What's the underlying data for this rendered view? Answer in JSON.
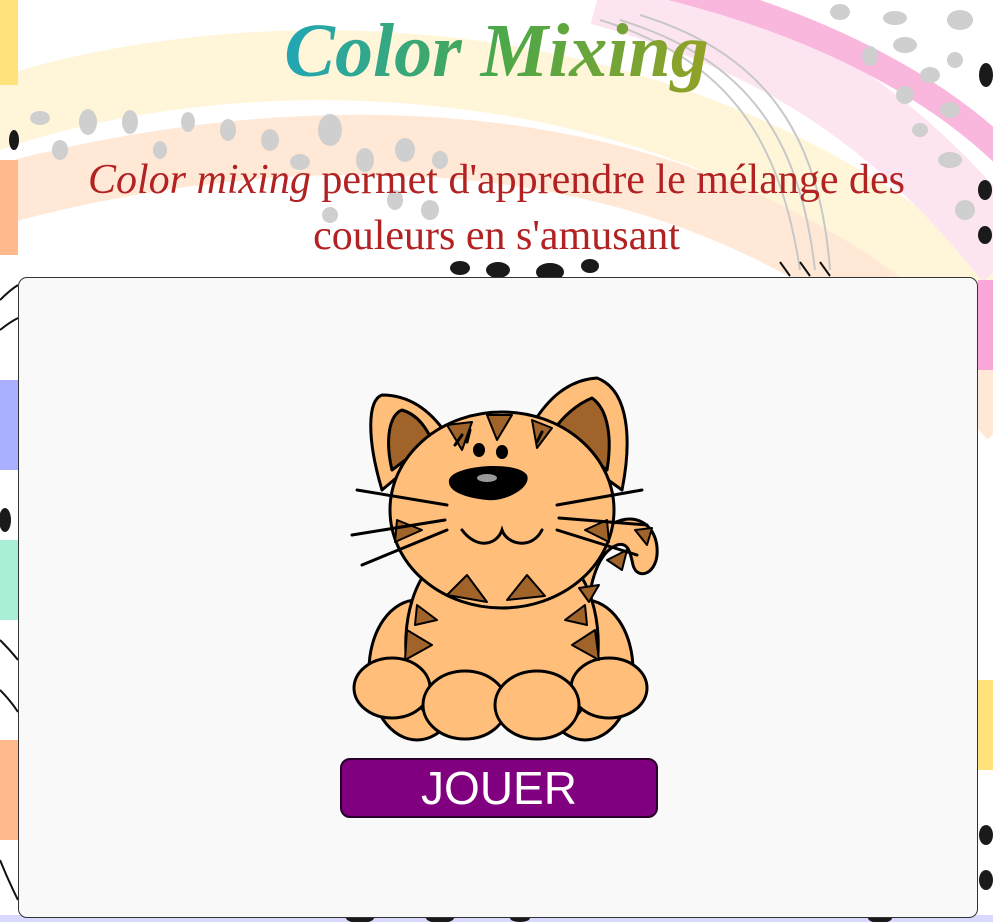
{
  "header": {
    "title": "Color Mixing",
    "subtitle_em": "Color mixing",
    "subtitle_rest": " permet d'apprendre le mélange des couleurs en s'amusant"
  },
  "main": {
    "illustration_icon": "cat-icon",
    "play_button_label": "JOUER"
  },
  "colors": {
    "title_gradient": [
      "#7b2fbe",
      "#1aa6c9",
      "#4aa84a",
      "#a0a020",
      "#ff8c00"
    ],
    "subtitle_text": "#b22222",
    "button_bg": "#800080",
    "panel_bg": "#f9f9f9"
  }
}
